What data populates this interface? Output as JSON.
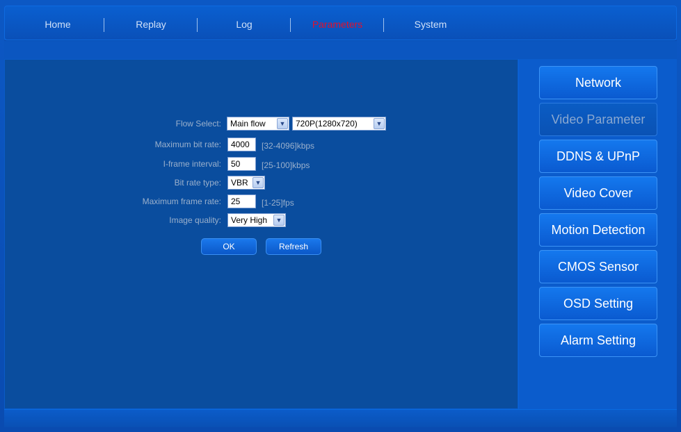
{
  "nav": {
    "items": [
      "Home",
      "Replay",
      "Log",
      "Parameters",
      "System"
    ],
    "active": "Parameters"
  },
  "form": {
    "flow_select": {
      "label": "Flow Select:",
      "flow": "Main flow",
      "resolution": "720P(1280x720)"
    },
    "max_bit_rate": {
      "label": "Maximum bit rate:",
      "value": "4000",
      "hint": "[32-4096]kbps"
    },
    "iframe_interval": {
      "label": "I-frame interval:",
      "value": "50",
      "hint": "[25-100]kbps"
    },
    "bit_rate_type": {
      "label": "Bit rate type:",
      "value": "VBR"
    },
    "max_frame_rate": {
      "label": "Maximum frame rate:",
      "value": "25",
      "hint": "[1-25]fps"
    },
    "image_quality": {
      "label": "Image quality:",
      "value": "Very High"
    },
    "ok_label": "OK",
    "refresh_label": "Refresh"
  },
  "sidebar": {
    "items": [
      "Network",
      "Video Parameter",
      "DDNS & UPnP",
      "Video Cover",
      "Motion Detection",
      "CMOS Sensor",
      "OSD Setting",
      "Alarm Setting"
    ],
    "active": "Video Parameter"
  },
  "colors": {
    "accent_active_nav": "#e0102e",
    "background": "#0a4d9e"
  }
}
